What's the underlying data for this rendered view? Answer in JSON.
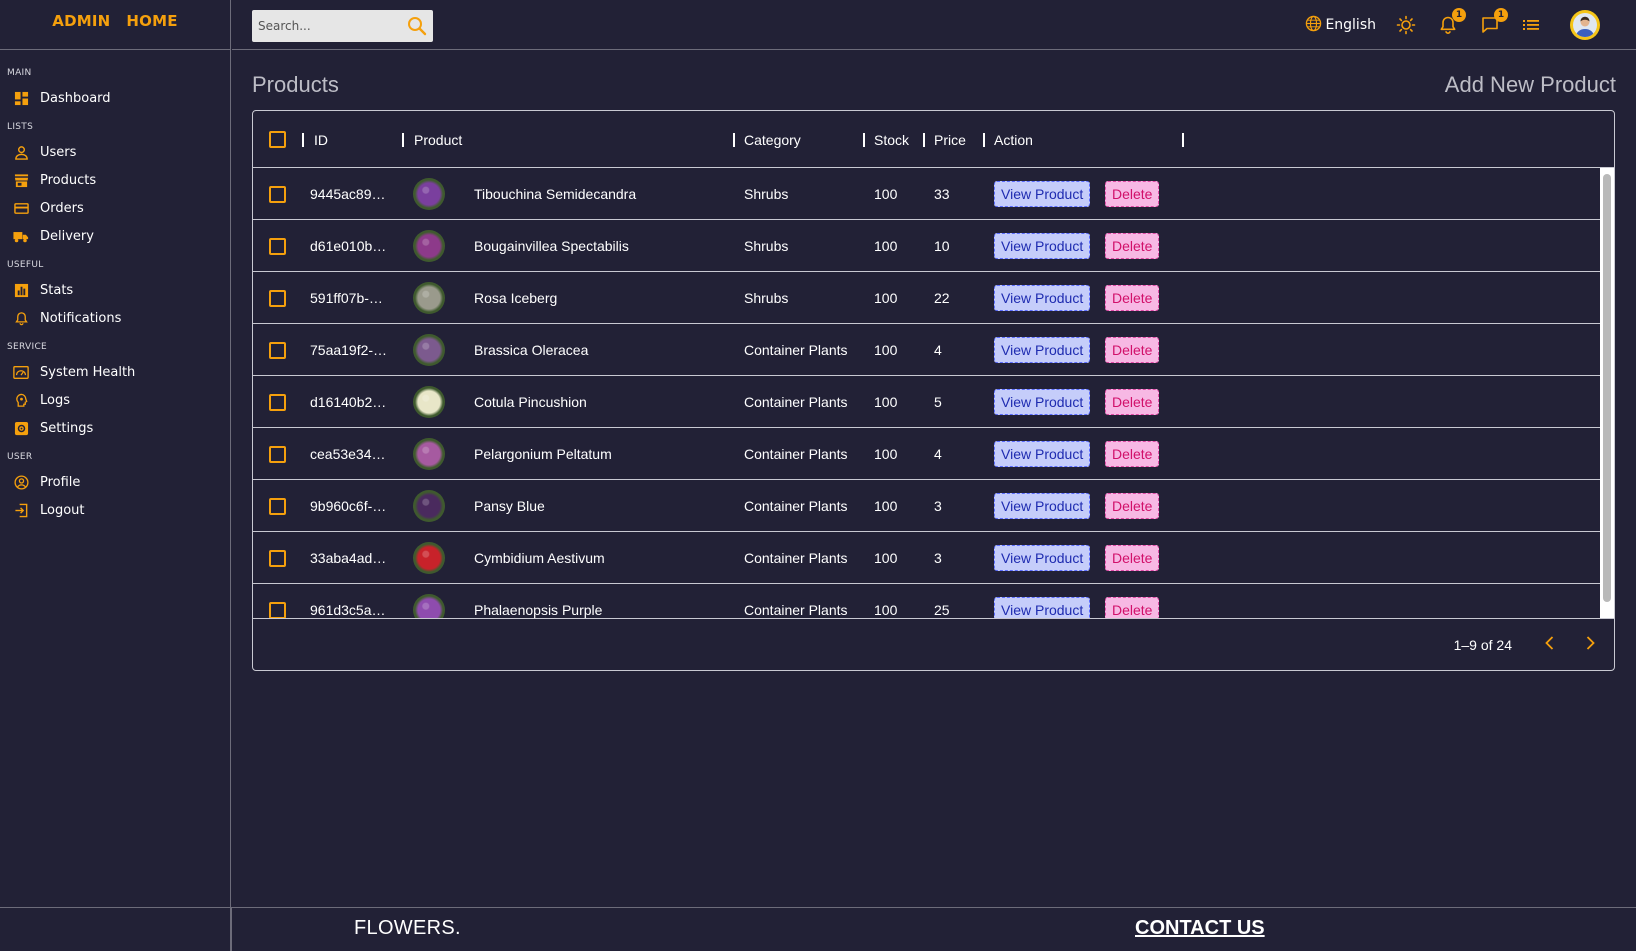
{
  "logo": {
    "part1": "ADMIN",
    "part2": "HOME"
  },
  "search": {
    "placeholder": "Search..."
  },
  "topbar": {
    "language": "English",
    "notifications_count": "1",
    "messages_count": "1"
  },
  "sidebar": {
    "sections": [
      {
        "title": "MAIN",
        "items": [
          {
            "label": "Dashboard",
            "icon": "dashboard-icon"
          }
        ]
      },
      {
        "title": "LISTS",
        "items": [
          {
            "label": "Users",
            "icon": "user-icon"
          },
          {
            "label": "Products",
            "icon": "store-icon"
          },
          {
            "label": "Orders",
            "icon": "credit-card-icon"
          },
          {
            "label": "Delivery",
            "icon": "truck-icon"
          }
        ]
      },
      {
        "title": "USEFUL",
        "items": [
          {
            "label": "Stats",
            "icon": "bar-chart-icon"
          },
          {
            "label": "Notifications",
            "icon": "bell-icon"
          }
        ]
      },
      {
        "title": "SERVICE",
        "items": [
          {
            "label": "System Health",
            "icon": "health-icon"
          },
          {
            "label": "Logs",
            "icon": "brain-icon"
          },
          {
            "label": "Settings",
            "icon": "settings-icon"
          }
        ]
      },
      {
        "title": "USER",
        "items": [
          {
            "label": "Profile",
            "icon": "account-circle-icon"
          },
          {
            "label": "Logout",
            "icon": "logout-icon"
          }
        ]
      }
    ]
  },
  "page": {
    "title": "Products",
    "add_new": "Add New Product"
  },
  "table": {
    "columns": {
      "id": "ID",
      "product": "Product",
      "category": "Category",
      "stock": "Stock",
      "price": "Price",
      "action": "Action"
    },
    "view_label": "View Product",
    "delete_label": "Delete",
    "rows": [
      {
        "id": "9445ac89…",
        "name": "Tibouchina Semidecandra",
        "category": "Shrubs",
        "stock": "100",
        "price": "33",
        "thumb": "#7a3f9e"
      },
      {
        "id": "d61e010b…",
        "name": "Bougainvillea Spectabilis",
        "category": "Shrubs",
        "stock": "100",
        "price": "10",
        "thumb": "#8d3a8a"
      },
      {
        "id": "591ff07b-…",
        "name": "Rosa Iceberg",
        "category": "Shrubs",
        "stock": "100",
        "price": "22",
        "thumb": "#9a9a8c"
      },
      {
        "id": "75aa19f2-…",
        "name": "Brassica Oleracea",
        "category": "Container Plants",
        "stock": "100",
        "price": "4",
        "thumb": "#7c5a8e"
      },
      {
        "id": "d16140b2…",
        "name": "Cotula Pincushion",
        "category": "Container Plants",
        "stock": "100",
        "price": "5",
        "thumb": "#e8e6c8"
      },
      {
        "id": "cea53e34…",
        "name": "Pelargonium Peltatum",
        "category": "Container Plants",
        "stock": "100",
        "price": "4",
        "thumb": "#a65aa0"
      },
      {
        "id": "9b960c6f-…",
        "name": "Pansy Blue",
        "category": "Container Plants",
        "stock": "100",
        "price": "3",
        "thumb": "#4a2a5e"
      },
      {
        "id": "33aba4ad…",
        "name": "Cymbidium Aestivum",
        "category": "Container Plants",
        "stock": "100",
        "price": "3",
        "thumb": "#c8222a"
      },
      {
        "id": "961d3c5a…",
        "name": "Phalaenopsis Purple",
        "category": "Container Plants",
        "stock": "100",
        "price": "25",
        "thumb": "#8e4cae"
      }
    ]
  },
  "pagination": {
    "text": "1–9 of 24"
  },
  "footer": {
    "brand": "FLOWERS.",
    "contact": "CONTACT US"
  },
  "colors": {
    "accent": "#f5a00d",
    "background": "#222136",
    "view_bg": "#c5cdfa",
    "delete_bg": "#f7b8e4"
  }
}
